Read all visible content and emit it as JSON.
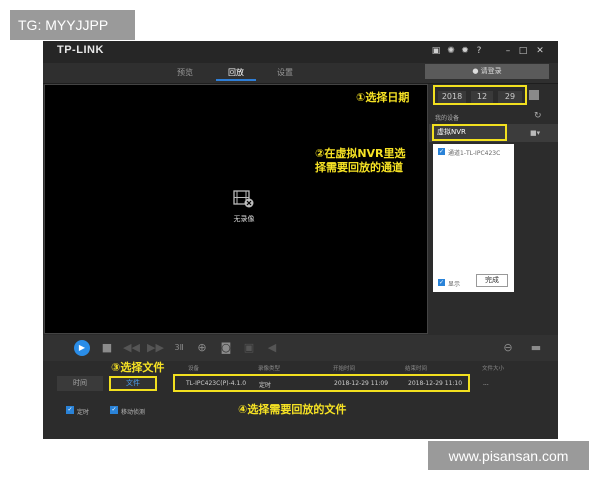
{
  "watermark_top": "TG: MYYJJPP",
  "watermark_bottom": "www.pisansan.com",
  "app": {
    "logo": "TP-LINK",
    "nav_tabs": [
      {
        "label": "预览",
        "active": false
      },
      {
        "label": "回放",
        "active": true
      },
      {
        "label": "设置",
        "active": false
      }
    ],
    "login_label": "请登录",
    "window_icons": [
      "screenshot-icon",
      "settings-icon",
      "gear-icon",
      "help-icon",
      "minimize-icon",
      "maximize-icon",
      "close-icon"
    ]
  },
  "video": {
    "no_video_label": "无录像"
  },
  "date": {
    "year": "2018",
    "month": "12",
    "day": "29"
  },
  "devices": {
    "heading": "我的设备",
    "selected_device": "虚拟NVR",
    "channel": "通道1-TL-IPC423C",
    "channel_checked": true,
    "show_all_label": "显示",
    "confirm_label": "完成"
  },
  "annotations": {
    "step1": "①选择日期",
    "step2_line1": "②在虚拟NVR里选",
    "step2_line2": "择需要回放的通道",
    "step3": "③选择文件",
    "step4": "④选择需要回放的文件"
  },
  "file_table": {
    "headers": [
      "设备",
      "录像类型",
      "开始时间",
      "结束时间",
      "文件大小"
    ],
    "tabs": [
      {
        "label": "时间",
        "active": false
      },
      {
        "label": "文件",
        "active": true
      }
    ],
    "row": {
      "device": "TL-IPC423C(P)-4.1.0",
      "type": "定时",
      "start": "2018-12-29 11:09",
      "end": "2018-12-29 11:10",
      "size": "..."
    }
  },
  "filters": [
    {
      "label": "定时",
      "checked": true
    },
    {
      "label": "移动侦测",
      "checked": true
    }
  ],
  "colors": {
    "accent": "#2a8de8",
    "annotation": "#f6e224",
    "app_bg": "#2c2c2c"
  }
}
